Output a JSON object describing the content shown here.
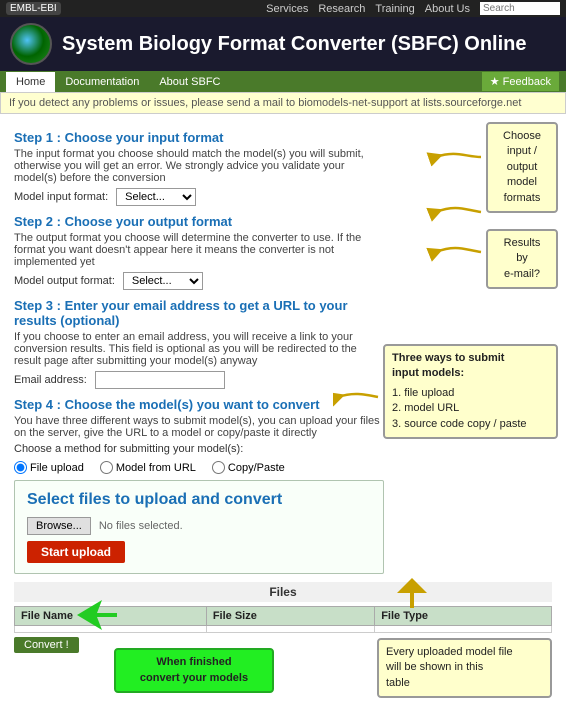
{
  "topbar": {
    "logo": "EMBL-EBI",
    "services": "Services",
    "research": "Research",
    "training": "Training",
    "about": "About Us",
    "search_placeholder": "Search"
  },
  "header": {
    "title": "System Biology Format Converter (SBFC) Online"
  },
  "nav": {
    "items": [
      "Home",
      "Documentation",
      "About SBFC"
    ],
    "active": "Home",
    "feedback": "★ Feedback"
  },
  "alert": {
    "text": "If you detect any problems or issues, please send a mail to biomodels-net-support at lists.sourceforge.net"
  },
  "steps": {
    "step1": {
      "title": "Step 1 : Choose your input format",
      "desc": "The input format you choose should match the model(s) you will submit, otherwise you will get an error. We strongly advice you validate your model(s) before the conversion",
      "label": "Model input format:",
      "select_placeholder": "Select..."
    },
    "step2": {
      "title": "Step 2 : Choose your output format",
      "desc": "The output format you choose will determine the converter to use. If the format you want doesn't appear here it means the converter is not implemented yet",
      "label": "Model output format:",
      "select_placeholder": "Select..."
    },
    "step3": {
      "title": "Step 3 : Enter your email address to get a URL to your results (optional)",
      "desc": "If you choose to enter an email address, you will receive a link to your conversion results. This field is optional as you will be redirected to the result page after submitting your model(s) anyway",
      "email_label": "Email address:"
    },
    "step4": {
      "title": "Step 4 : Choose the model(s) you want to convert",
      "desc": "You have three different ways to submit model(s), you can upload your files on the server, give the URL to a model or copy/paste it directly"
    }
  },
  "submit_section": {
    "label": "Choose a method for submitting your model(s):",
    "radio_options": [
      "File upload",
      "Model from URL",
      "Copy/Paste"
    ],
    "upload": {
      "title": "Select files to upload and convert",
      "browse_label": "Browse...",
      "no_file": "No files selected.",
      "start_button": "Start upload"
    }
  },
  "files_table": {
    "header": "Files",
    "columns": [
      "File Name",
      "File Size",
      "File Type"
    ],
    "convert_button": "Convert !"
  },
  "annotations": {
    "formats": {
      "lines": [
        "Choose",
        "input /",
        "output",
        "model",
        "formats"
      ]
    },
    "email": {
      "lines": [
        "Results",
        "by",
        "e-mail?"
      ]
    },
    "three_ways": {
      "lines": [
        "Three ways to submit",
        "input models:",
        "",
        "1. file upload",
        "2. model URL",
        "3. source code copy / paste"
      ]
    },
    "when_finished": {
      "lines": [
        "When finished",
        "convert your models"
      ]
    },
    "every_uploaded": {
      "lines": [
        "Every uploaded model file",
        "will be shown in this",
        "table"
      ]
    }
  }
}
